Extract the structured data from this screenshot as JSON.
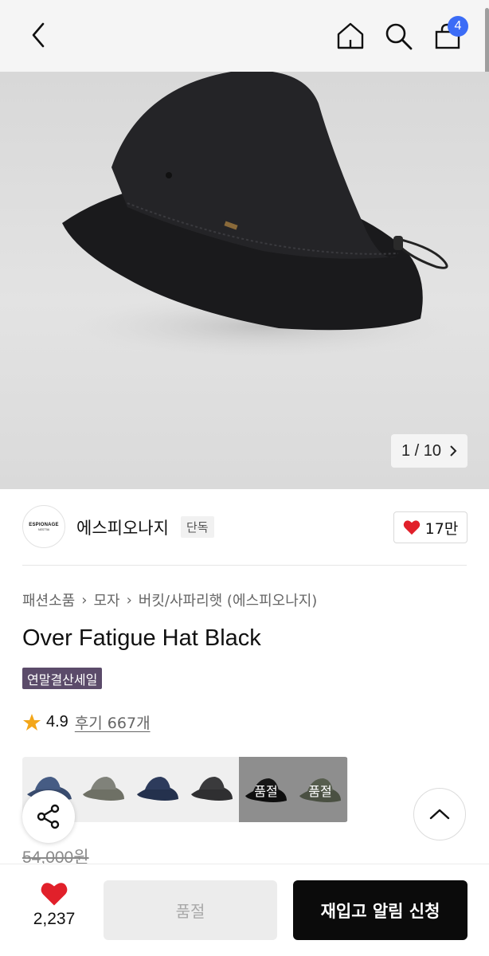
{
  "header": {
    "back_icon": "chevron-left-icon",
    "home_icon": "home-icon",
    "search_icon": "search-icon",
    "cart_icon": "shopping-bag-icon",
    "cart_count": "4",
    "badge_color": "#3b6cf6"
  },
  "gallery": {
    "counter_text": "1 / 10",
    "next_icon": "chevron-right-icon"
  },
  "brand": {
    "logo_line1": "ESPIONAGE",
    "logo_line2": "NEST'56",
    "name": "에스피오나지",
    "exclusive_label": "단독",
    "likes": "17만",
    "like_color": "#e1202a"
  },
  "breadcrumb": [
    "패션소품",
    "모자",
    "버킷/사파리햇 (에스피오나지)"
  ],
  "product": {
    "title": "Over Fatigue Hat Black",
    "sale_badge": "연말결산세일",
    "rating": "4.9",
    "reviews": "후기 667개",
    "original_price": "54,000원"
  },
  "color_options": [
    {
      "color": "navy-blue",
      "sold_out": false
    },
    {
      "color": "khaki-grey",
      "sold_out": false
    },
    {
      "color": "navy",
      "sold_out": false
    },
    {
      "color": "charcoal",
      "sold_out": false
    },
    {
      "color": "black",
      "sold_out": true,
      "label": "품절"
    },
    {
      "color": "olive",
      "sold_out": true,
      "label": "품절"
    }
  ],
  "bottom_bar": {
    "wish_count": "2,237",
    "soldout_label": "품절",
    "restock_label": "재입고 알림 신청"
  }
}
